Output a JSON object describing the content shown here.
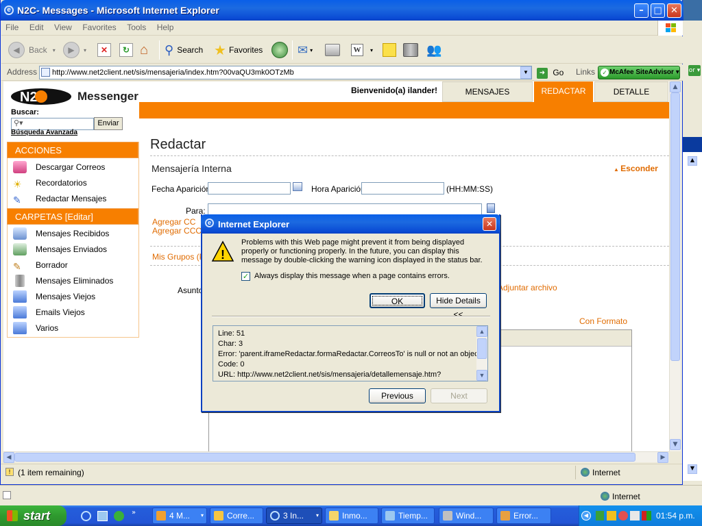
{
  "window": {
    "title": "N2C- Messages - Microsoft Internet Explorer",
    "controls": [
      "minimize",
      "maximize",
      "close"
    ]
  },
  "menubar": [
    "File",
    "Edit",
    "View",
    "Favorites",
    "Tools",
    "Help"
  ],
  "toolbar": {
    "back": "Back",
    "search": "Search",
    "favorites": "Favorites"
  },
  "addressbar": {
    "label": "Address",
    "url": "http://www.net2client.net/sis/mensajeria/index.htm?00vaQU3mk0OTzMb",
    "go": "Go",
    "links": "Links",
    "siteadvisor": "McAfee SiteAdvisor"
  },
  "site": {
    "logo_text": "N2C",
    "app_name": "Messenger",
    "welcome": "Bienvenido(a) ilander!",
    "tabs": [
      "MENSAJES RECIBIDOS",
      "REDACTAR",
      "DETALLE MENSAJE"
    ],
    "active_tab": "REDACTAR",
    "search": {
      "label": "Buscar:",
      "button": "Enviar",
      "advanced": "Búsqueda Avanzada"
    },
    "sections": {
      "actions_title": "ACCIONES",
      "actions": [
        "Descargar Correos",
        "Recordatorios",
        "Redactar Mensajes"
      ],
      "folders_title": "CARPETAS [Editar]",
      "folders": [
        "Mensajes Recibidos",
        "Mensajes Enviados",
        "Borrador",
        "Mensajes Eliminados",
        "Mensajes Viejos",
        "Emails Viejos",
        "Varios"
      ]
    }
  },
  "compose": {
    "page_title": "Redactar",
    "subtitle": "Mensajería Interna",
    "hide": "Esconder",
    "fecha_label": "Fecha Aparición",
    "hora_label": "Hora Aparición",
    "hora_format": "(HH:MM:SS)",
    "para_label": "Para:",
    "cc": "Agregar CC",
    "cco": "Agregar CCO",
    "groups": "Mis Grupos (Pr",
    "asunto_label": "Asunto",
    "attach": "Adjuntar archivo",
    "format": "Con Formato"
  },
  "dialog": {
    "title": "Internet Explorer",
    "message": "Problems with this Web page might prevent it from being displayed properly or functioning properly. In the future, you can display this message by double-clicking the warning icon displayed in the status bar.",
    "checkbox_label": "Always display this message when a page contains errors.",
    "checkbox_checked": true,
    "ok": "OK",
    "hide_details": "Hide Details <<",
    "details": {
      "line": "Line:  51",
      "char": "Char:  3",
      "error": "Error:  'parent.iframeRedactar.formaRedactar.CorreosTo' is null or not an object",
      "code": "Code: 0",
      "url": "URL:  http://www.net2client.net/sis/mensajeria/detallemensaje.htm?"
    },
    "previous": "Previous",
    "next": "Next"
  },
  "statusbar": {
    "text": "(1 item remaining)",
    "zone": "Internet"
  },
  "outer_status": {
    "zone": "Internet"
  },
  "taskbar": {
    "start": "start",
    "tasks": [
      "4 M...",
      "Corre...",
      "3 In...",
      "Inmo...",
      "Tiemp...",
      "Wind...",
      "Error..."
    ],
    "active_task": "3 In...",
    "clock": "01:54 p.m."
  },
  "colors": {
    "accent_orange": "#f77f00",
    "xp_blue": "#0a5fe8",
    "link_orange": "#e06b00"
  }
}
